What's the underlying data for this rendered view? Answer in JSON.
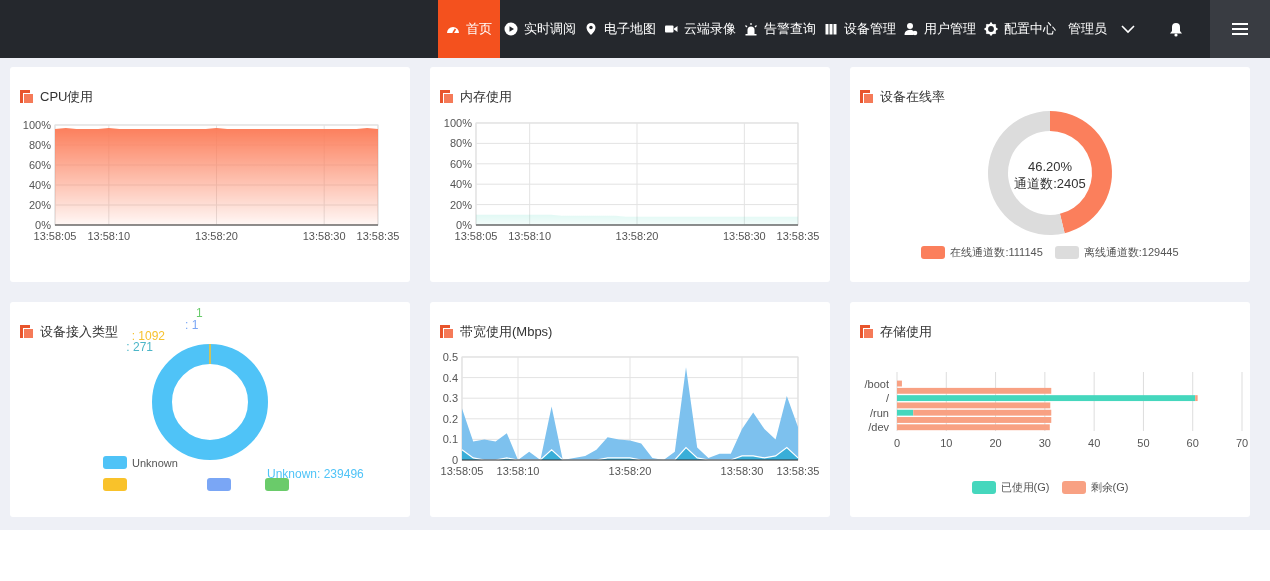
{
  "nav": {
    "items": [
      {
        "label": "首页",
        "selected": true
      },
      {
        "label": "实时调阅",
        "selected": false
      },
      {
        "label": "电子地图",
        "selected": false
      },
      {
        "label": "云端录像",
        "selected": false
      },
      {
        "label": "告警查询",
        "selected": false
      },
      {
        "label": "设备管理",
        "selected": false
      },
      {
        "label": "用户管理",
        "selected": false
      },
      {
        "label": "配置中心",
        "selected": false
      }
    ],
    "user": "管理员"
  },
  "cards": [
    {
      "title": "CPU使用",
      "chart_data": {
        "type": "area",
        "grid": true,
        "categories": [
          "13:58:05",
          null,
          null,
          null,
          null,
          "13:58:10",
          null,
          null,
          null,
          null,
          null,
          null,
          null,
          null,
          null,
          "13:58:20",
          null,
          null,
          null,
          null,
          null,
          null,
          null,
          null,
          null,
          "13:58:30",
          null,
          null,
          null,
          null,
          "13:58:35"
        ],
        "ylim": [
          0,
          100
        ],
        "yticks": [
          {
            "value": 0,
            "label": "0%"
          },
          {
            "value": 20,
            "label": "20%"
          },
          {
            "value": 40,
            "label": "40%"
          },
          {
            "value": 60,
            "label": "60%"
          },
          {
            "value": 80,
            "label": "80%"
          },
          {
            "value": 100,
            "label": "100%"
          }
        ],
        "series": [
          {
            "color": "#fc7b57",
            "values": [
              96,
              97,
              96,
              96,
              96,
              97,
              96,
              96,
              96,
              96,
              96,
              96,
              96,
              96,
              96,
              97,
              96,
              96,
              96,
              96,
              96,
              96,
              96,
              96,
              96,
              96,
              96,
              96,
              96,
              97,
              96
            ]
          }
        ]
      }
    },
    {
      "title": "内存使用",
      "chart_data": {
        "type": "area",
        "grid": true,
        "categories": [
          "13:58:05",
          null,
          null,
          null,
          null,
          "13:58:10",
          null,
          null,
          null,
          null,
          null,
          null,
          null,
          null,
          null,
          "13:58:20",
          null,
          null,
          null,
          null,
          null,
          null,
          null,
          null,
          null,
          "13:58:30",
          null,
          null,
          null,
          null,
          "13:58:35"
        ],
        "ylim": [
          0,
          100
        ],
        "yticks": [
          {
            "value": 0,
            "label": "0%"
          },
          {
            "value": 20,
            "label": "20%"
          },
          {
            "value": 40,
            "label": "40%"
          },
          {
            "value": 60,
            "label": "60%"
          },
          {
            "value": 80,
            "label": "80%"
          },
          {
            "value": 100,
            "label": "100%"
          }
        ],
        "series": [
          {
            "color": "#3fd6b9",
            "values": [
              10,
              10,
              10,
              10,
              10,
              10,
              10,
              10,
              9,
              9,
              9,
              9,
              9,
              9,
              8,
              8,
              8,
              8,
              8,
              8,
              8,
              8,
              8,
              8,
              8,
              8,
              8,
              8,
              8,
              8,
              8
            ]
          }
        ]
      }
    },
    {
      "title": "设备在线率",
      "center": [
        "46.20%",
        "通道数:2405"
      ],
      "chart_data": {
        "type": "donut",
        "categories": [
          "在线通道数:111145",
          "离线通道数:129445"
        ],
        "values": [
          46.2,
          53.8
        ],
        "colors": [
          "#fb7f5c",
          "#dcdcdc"
        ]
      }
    },
    {
      "title": "设备接入类型",
      "labels": [
        {
          "text": "Unknown: 239496",
          "color": "#4fc3f7"
        },
        {
          "text": ": 1092",
          "color": "#f7c22e"
        },
        {
          "text": ": 271",
          "color": "#4cb6c8"
        },
        {
          "text": "1",
          "color": "#6acb6c"
        },
        {
          "text": ": 1",
          "color": "#7aa6f5"
        }
      ],
      "legend": [
        [
          {
            "label": "Unknown",
            "color": "#4fc3f7"
          }
        ],
        [
          {
            "color": "#f9c22a"
          },
          {
            "color": "#7aa6f5"
          },
          {
            "color": "#6acb6a"
          }
        ]
      ]
    },
    {
      "title": "带宽使用(Mbps)",
      "chart_data": {
        "type": "area",
        "categories": [
          "13:58:05",
          null,
          null,
          null,
          null,
          "13:58:10",
          null,
          null,
          null,
          null,
          null,
          null,
          null,
          null,
          null,
          "13:58:20",
          null,
          null,
          null,
          null,
          null,
          null,
          null,
          null,
          null,
          "13:58:30",
          null,
          null,
          null,
          null,
          "13:58:35"
        ],
        "ylim": [
          0,
          0.5
        ],
        "grid": true,
        "yticks": [
          {
            "value": 0,
            "label": "0"
          },
          {
            "value": 0.1,
            "label": "0.1"
          },
          {
            "value": 0.2,
            "label": "0.2"
          },
          {
            "value": 0.3,
            "label": "0.3"
          },
          {
            "value": 0.4,
            "label": "0.4"
          },
          {
            "value": 0.5,
            "label": "0.5"
          }
        ],
        "series": [
          {
            "color": "#7dc1ee",
            "values": [
              0.25,
              0.09,
              0.1,
              0.09,
              0.13,
              0,
              0.04,
              0,
              0.26,
              0,
              0.01,
              0.02,
              0.05,
              0.11,
              0.1,
              0.095,
              0.08,
              0.01,
              0,
              0.04,
              0.45,
              0.06,
              0.01,
              0.03,
              0.03,
              0.15,
              0.23,
              0.15,
              0.1,
              0.31,
              0.16
            ]
          },
          {
            "color": "#39aed8",
            "values": [
              0.05,
              0.01,
              0,
              0,
              0.01,
              0,
              0,
              0,
              0.05,
              0,
              0,
              0,
              0,
              0.01,
              0.01,
              0.01,
              0,
              0,
              0,
              0,
              0.06,
              0.01,
              0,
              0,
              0,
              0.02,
              0.02,
              0.01,
              0.02,
              0.06,
              0.01
            ]
          }
        ]
      }
    },
    {
      "title": "存储使用",
      "chart_data": {
        "type": "bar",
        "orientation": "horizontal",
        "stacked": true,
        "grid": true,
        "categories": [
          "/boot",
          null,
          "/",
          null,
          "/run",
          null,
          "/dev"
        ],
        "xlim": [
          0,
          70
        ],
        "xticks": [
          {
            "value": 0,
            "label": "0"
          },
          {
            "value": 10,
            "label": "10"
          },
          {
            "value": 20,
            "label": "20"
          },
          {
            "value": 30,
            "label": "30"
          },
          {
            "value": 40,
            "label": "40"
          },
          {
            "value": 50,
            "label": "50"
          },
          {
            "value": 60,
            "label": "60"
          },
          {
            "value": 70,
            "label": "70"
          }
        ],
        "series": [
          {
            "name": "已使用(G)",
            "color": "#45d7bd",
            "values": [
              0,
              0,
              60.5,
              0,
              3.3,
              0,
              0
            ]
          },
          {
            "name": "剩余(G)",
            "color": "#f8a183",
            "values": [
              1,
              31.3,
              0.5,
              31.1,
              28,
              31.3,
              31
            ]
          }
        ]
      }
    }
  ]
}
